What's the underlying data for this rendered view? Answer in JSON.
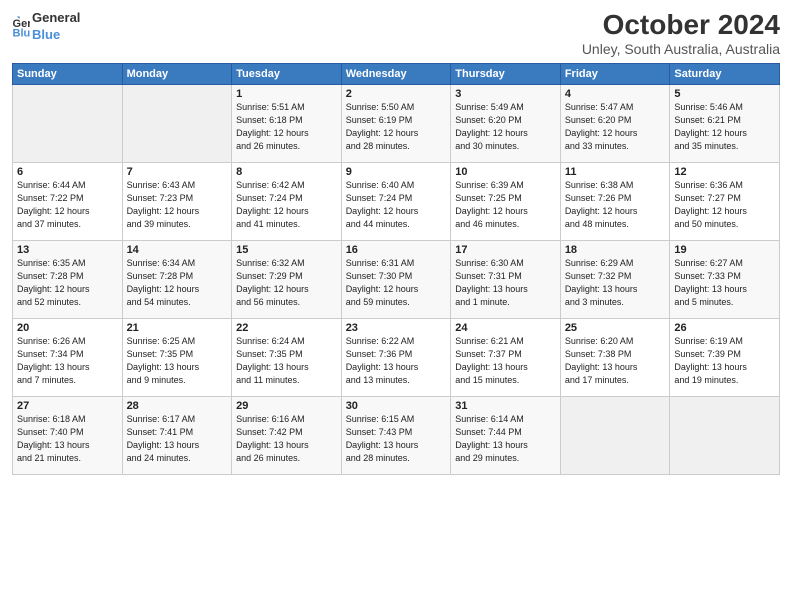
{
  "logo": {
    "line1": "General",
    "line2": "Blue"
  },
  "title": "October 2024",
  "subtitle": "Unley, South Australia, Australia",
  "days_header": [
    "Sunday",
    "Monday",
    "Tuesday",
    "Wednesday",
    "Thursday",
    "Friday",
    "Saturday"
  ],
  "weeks": [
    [
      {
        "day": "",
        "sunrise": "",
        "sunset": "",
        "daylight": ""
      },
      {
        "day": "",
        "sunrise": "",
        "sunset": "",
        "daylight": ""
      },
      {
        "day": "1",
        "sunrise": "Sunrise: 5:51 AM",
        "sunset": "Sunset: 6:18 PM",
        "daylight": "Daylight: 12 hours and 26 minutes."
      },
      {
        "day": "2",
        "sunrise": "Sunrise: 5:50 AM",
        "sunset": "Sunset: 6:19 PM",
        "daylight": "Daylight: 12 hours and 28 minutes."
      },
      {
        "day": "3",
        "sunrise": "Sunrise: 5:49 AM",
        "sunset": "Sunset: 6:20 PM",
        "daylight": "Daylight: 12 hours and 30 minutes."
      },
      {
        "day": "4",
        "sunrise": "Sunrise: 5:47 AM",
        "sunset": "Sunset: 6:20 PM",
        "daylight": "Daylight: 12 hours and 33 minutes."
      },
      {
        "day": "5",
        "sunrise": "Sunrise: 5:46 AM",
        "sunset": "Sunset: 6:21 PM",
        "daylight": "Daylight: 12 hours and 35 minutes."
      }
    ],
    [
      {
        "day": "6",
        "sunrise": "Sunrise: 6:44 AM",
        "sunset": "Sunset: 7:22 PM",
        "daylight": "Daylight: 12 hours and 37 minutes."
      },
      {
        "day": "7",
        "sunrise": "Sunrise: 6:43 AM",
        "sunset": "Sunset: 7:23 PM",
        "daylight": "Daylight: 12 hours and 39 minutes."
      },
      {
        "day": "8",
        "sunrise": "Sunrise: 6:42 AM",
        "sunset": "Sunset: 7:24 PM",
        "daylight": "Daylight: 12 hours and 41 minutes."
      },
      {
        "day": "9",
        "sunrise": "Sunrise: 6:40 AM",
        "sunset": "Sunset: 7:24 PM",
        "daylight": "Daylight: 12 hours and 44 minutes."
      },
      {
        "day": "10",
        "sunrise": "Sunrise: 6:39 AM",
        "sunset": "Sunset: 7:25 PM",
        "daylight": "Daylight: 12 hours and 46 minutes."
      },
      {
        "day": "11",
        "sunrise": "Sunrise: 6:38 AM",
        "sunset": "Sunset: 7:26 PM",
        "daylight": "Daylight: 12 hours and 48 minutes."
      },
      {
        "day": "12",
        "sunrise": "Sunrise: 6:36 AM",
        "sunset": "Sunset: 7:27 PM",
        "daylight": "Daylight: 12 hours and 50 minutes."
      }
    ],
    [
      {
        "day": "13",
        "sunrise": "Sunrise: 6:35 AM",
        "sunset": "Sunset: 7:28 PM",
        "daylight": "Daylight: 12 hours and 52 minutes."
      },
      {
        "day": "14",
        "sunrise": "Sunrise: 6:34 AM",
        "sunset": "Sunset: 7:28 PM",
        "daylight": "Daylight: 12 hours and 54 minutes."
      },
      {
        "day": "15",
        "sunrise": "Sunrise: 6:32 AM",
        "sunset": "Sunset: 7:29 PM",
        "daylight": "Daylight: 12 hours and 56 minutes."
      },
      {
        "day": "16",
        "sunrise": "Sunrise: 6:31 AM",
        "sunset": "Sunset: 7:30 PM",
        "daylight": "Daylight: 12 hours and 59 minutes."
      },
      {
        "day": "17",
        "sunrise": "Sunrise: 6:30 AM",
        "sunset": "Sunset: 7:31 PM",
        "daylight": "Daylight: 13 hours and 1 minute."
      },
      {
        "day": "18",
        "sunrise": "Sunrise: 6:29 AM",
        "sunset": "Sunset: 7:32 PM",
        "daylight": "Daylight: 13 hours and 3 minutes."
      },
      {
        "day": "19",
        "sunrise": "Sunrise: 6:27 AM",
        "sunset": "Sunset: 7:33 PM",
        "daylight": "Daylight: 13 hours and 5 minutes."
      }
    ],
    [
      {
        "day": "20",
        "sunrise": "Sunrise: 6:26 AM",
        "sunset": "Sunset: 7:34 PM",
        "daylight": "Daylight: 13 hours and 7 minutes."
      },
      {
        "day": "21",
        "sunrise": "Sunrise: 6:25 AM",
        "sunset": "Sunset: 7:35 PM",
        "daylight": "Daylight: 13 hours and 9 minutes."
      },
      {
        "day": "22",
        "sunrise": "Sunrise: 6:24 AM",
        "sunset": "Sunset: 7:35 PM",
        "daylight": "Daylight: 13 hours and 11 minutes."
      },
      {
        "day": "23",
        "sunrise": "Sunrise: 6:22 AM",
        "sunset": "Sunset: 7:36 PM",
        "daylight": "Daylight: 13 hours and 13 minutes."
      },
      {
        "day": "24",
        "sunrise": "Sunrise: 6:21 AM",
        "sunset": "Sunset: 7:37 PM",
        "daylight": "Daylight: 13 hours and 15 minutes."
      },
      {
        "day": "25",
        "sunrise": "Sunrise: 6:20 AM",
        "sunset": "Sunset: 7:38 PM",
        "daylight": "Daylight: 13 hours and 17 minutes."
      },
      {
        "day": "26",
        "sunrise": "Sunrise: 6:19 AM",
        "sunset": "Sunset: 7:39 PM",
        "daylight": "Daylight: 13 hours and 19 minutes."
      }
    ],
    [
      {
        "day": "27",
        "sunrise": "Sunrise: 6:18 AM",
        "sunset": "Sunset: 7:40 PM",
        "daylight": "Daylight: 13 hours and 21 minutes."
      },
      {
        "day": "28",
        "sunrise": "Sunrise: 6:17 AM",
        "sunset": "Sunset: 7:41 PM",
        "daylight": "Daylight: 13 hours and 24 minutes."
      },
      {
        "day": "29",
        "sunrise": "Sunrise: 6:16 AM",
        "sunset": "Sunset: 7:42 PM",
        "daylight": "Daylight: 13 hours and 26 minutes."
      },
      {
        "day": "30",
        "sunrise": "Sunrise: 6:15 AM",
        "sunset": "Sunset: 7:43 PM",
        "daylight": "Daylight: 13 hours and 28 minutes."
      },
      {
        "day": "31",
        "sunrise": "Sunrise: 6:14 AM",
        "sunset": "Sunset: 7:44 PM",
        "daylight": "Daylight: 13 hours and 29 minutes."
      },
      {
        "day": "",
        "sunrise": "",
        "sunset": "",
        "daylight": ""
      },
      {
        "day": "",
        "sunrise": "",
        "sunset": "",
        "daylight": ""
      }
    ]
  ]
}
